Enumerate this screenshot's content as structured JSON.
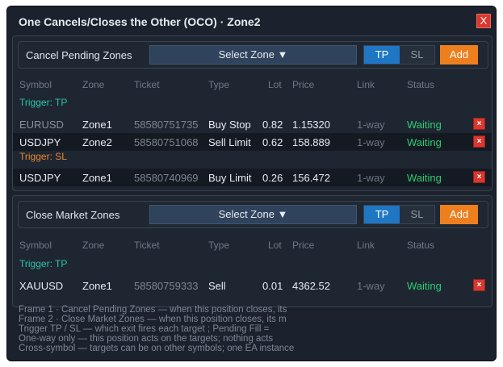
{
  "window": {
    "title": "One Cancels/Closes the Other (OCO)  ·  Zone2",
    "close_label": "X"
  },
  "columns": [
    "Symbol",
    "Zone",
    "Ticket",
    "Type",
    "Lot",
    "Price",
    "Link",
    "Status"
  ],
  "frame1": {
    "title": "Cancel Pending Zones",
    "select_label": "Select Zone  ▼",
    "toggle": {
      "tp": "TP",
      "sl": "SL",
      "selected": "TP"
    },
    "add_label": "Add",
    "trigger_tp": "Trigger: TP",
    "trigger_sl": "Trigger: SL",
    "tp_rows": [
      {
        "symbol": "EURUSD",
        "zone": "Zone1",
        "ticket": "58580751735",
        "type": "Buy Stop",
        "lot": "0.82",
        "price": "1.15320",
        "link": "1-way",
        "status": "Waiting"
      },
      {
        "symbol": "USDJPY",
        "zone": "Zone2",
        "ticket": "58580751068",
        "type": "Sell Limit",
        "lot": "0.62",
        "price": "158.889",
        "link": "1-way",
        "status": "Waiting"
      }
    ],
    "sl_rows": [
      {
        "symbol": "USDJPY",
        "zone": "Zone1",
        "ticket": "58580740969",
        "type": "Buy Limit",
        "lot": "0.26",
        "price": "156.472",
        "link": "1-way",
        "status": "Waiting"
      }
    ]
  },
  "frame2": {
    "title": "Close Market Zones",
    "select_label": "Select Zone  ▼",
    "toggle": {
      "tp": "TP",
      "sl": "SL",
      "selected": "TP"
    },
    "add_label": "Add",
    "trigger_tp": "Trigger: TP",
    "tp_rows": [
      {
        "symbol": "XAUUSD",
        "zone": "Zone1",
        "ticket": "58580759333",
        "type": "Sell",
        "lot": "0.01",
        "price": "4362.52",
        "link": "1-way",
        "status": "Waiting"
      }
    ]
  },
  "delete_label": "×",
  "notes": [
    "Frame 1 · Cancel Pending Zones — when this position closes, its",
    "Frame 2 · Close Market Zones — when this position closes, its m",
    "Trigger TP / SL — which exit fires each target ; Pending Fill =",
    "One-way only — this position acts on the targets; nothing acts",
    "Cross-symbol — targets can be on other symbols; one EA instance"
  ],
  "colors": {
    "background": "#1b222d",
    "accent_blue": "#1f77c4",
    "accent_orange": "#ee7f1e",
    "status_green": "#2ecc71",
    "trigger_tp": "#2ec4a8",
    "trigger_sl": "#e68a2e",
    "delete_red": "#d9372f"
  }
}
